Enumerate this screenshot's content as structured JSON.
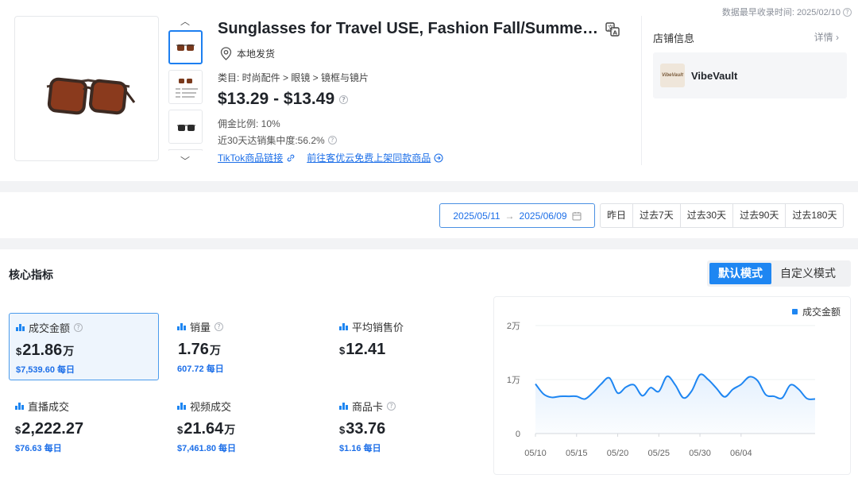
{
  "earliest": {
    "label": "数据最早收录时间: 2025/02/10"
  },
  "product": {
    "title": "Sunglasses for Travel USE, Fashion Fall/Summer Sunglasses",
    "shipping": "本地发货",
    "category": "类目: 时尚配件 > 眼镜 > 镜框与镜片",
    "price": "$13.29 - $13.49",
    "commission": "佣金比例: 10%",
    "concentration": "近30天达销集中度:56.2%",
    "link_tiktok": "TikTok商品链接",
    "link_list": "前往客优云免费上架同款商品"
  },
  "shop": {
    "section_title": "店铺信息",
    "detail": "详情",
    "name": "VibeVault",
    "logo_text": "VibeVault"
  },
  "daterange": {
    "start": "2025/05/11",
    "arrow": "→",
    "end": "2025/06/09"
  },
  "quick_ranges": [
    "昨日",
    "过去7天",
    "过去30天",
    "过去90天",
    "过去180天"
  ],
  "core": {
    "title": "核心指标",
    "modes": [
      "默认模式",
      "自定义模式"
    ]
  },
  "metrics": [
    {
      "label": "成交金额",
      "currency": "$",
      "value": "21.86",
      "unit": "万",
      "daily": "$7,539.60 每日",
      "help": true
    },
    {
      "label": "销量",
      "currency": "",
      "value": "1.76",
      "unit": "万",
      "daily": "607.72 每日",
      "help": true
    },
    {
      "label": "平均销售价",
      "currency": "$",
      "value": "12.41",
      "unit": "",
      "daily": "",
      "help": false
    },
    {
      "label": "直播成交",
      "currency": "$",
      "value": "2,222.27",
      "unit": "",
      "daily": "$76.63 每日",
      "help": false
    },
    {
      "label": "视频成交",
      "currency": "$",
      "value": "21.64",
      "unit": "万",
      "daily": "$7,461.80 每日",
      "help": false
    },
    {
      "label": "商品卡",
      "currency": "$",
      "value": "33.76",
      "unit": "",
      "daily": "$1.16 每日",
      "help": true
    }
  ],
  "colors": {
    "accent": "#1e86f2",
    "link": "#1d6fe8"
  },
  "chart_data": {
    "type": "area",
    "series": [
      {
        "name": "成交金额",
        "values": [
          9200,
          7300,
          6700,
          6900,
          6900,
          6900,
          6400,
          7600,
          9200,
          10300,
          7500,
          8600,
          9000,
          7000,
          8500,
          7800,
          10600,
          9000,
          6600,
          7900,
          10900,
          10000,
          8400,
          6800,
          8200,
          9100,
          10500,
          9800,
          7200,
          6900,
          6600,
          9000,
          8200,
          6500,
          6400
        ]
      }
    ],
    "x": [
      "05/10",
      "05/11",
      "05/12",
      "05/13",
      "05/14",
      "05/15",
      "05/16",
      "05/17",
      "05/18",
      "05/19",
      "05/20",
      "05/21",
      "05/22",
      "05/23",
      "05/24",
      "05/25",
      "05/26",
      "05/27",
      "05/28",
      "05/29",
      "05/30",
      "05/31",
      "06/01",
      "06/02",
      "06/03",
      "06/04",
      "06/05",
      "06/06",
      "06/07",
      "06/08",
      "06/09",
      "06/10",
      "06/11",
      "06/12",
      "06/13"
    ],
    "xticks": [
      "05/10",
      "05/15",
      "05/20",
      "05/25",
      "05/30",
      "06/04"
    ],
    "yticks": [
      "0",
      "1万",
      "2万"
    ],
    "ylim": [
      0,
      20000
    ],
    "legend": "top-right",
    "grid": true
  }
}
